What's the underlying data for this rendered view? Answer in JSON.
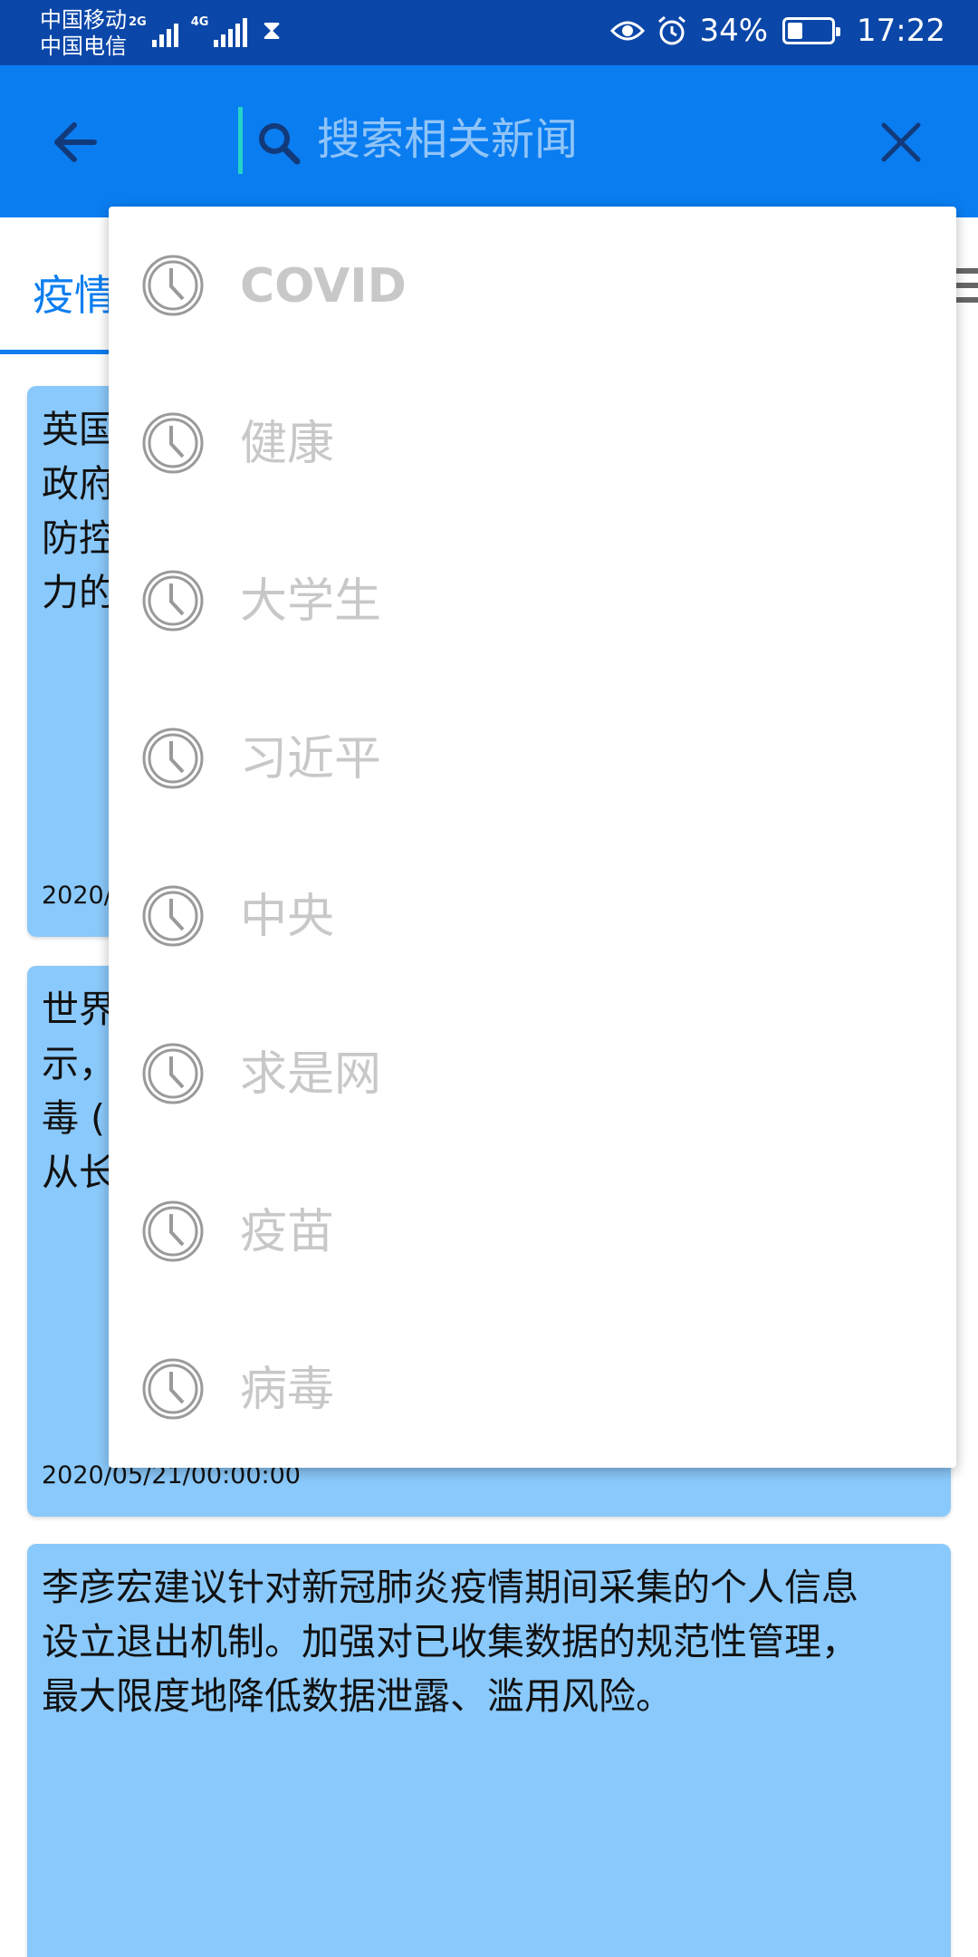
{
  "status_bar": {
    "carrier_1": "中国移动",
    "carrier_2": "中国电信",
    "network_1": "2G",
    "network_2": "4G",
    "battery_percent": "34%",
    "battery_level": 0.34,
    "time": "17:22"
  },
  "search": {
    "placeholder": "搜索相关新闻",
    "value": ""
  },
  "tabs": {
    "active_label": "疫情"
  },
  "history": {
    "items": [
      "COVID",
      "健康",
      "大学生",
      "习近平",
      "中央",
      "求是网",
      "疫苗",
      "病毒"
    ]
  },
  "news": {
    "cards": [
      {
        "text": "英国\n政府\n防控\n力的",
        "date": "2020/"
      },
      {
        "text": "世界\n示，\n毒 (\n从长",
        "date": "2020/05/21/00:00:00"
      },
      {
        "text": "李彦宏建议针对新冠肺炎疫情期间采集的个人信息\n设立退出机制。加强对已收集数据的规范性管理，\n最大限度地降低数据泄露、滥用风险。",
        "date": ""
      }
    ]
  },
  "colors": {
    "status_bar": "#0b47a8",
    "app_bar": "#0a7df0",
    "card": "#8ac9fb",
    "accent": "#0a7df0"
  }
}
